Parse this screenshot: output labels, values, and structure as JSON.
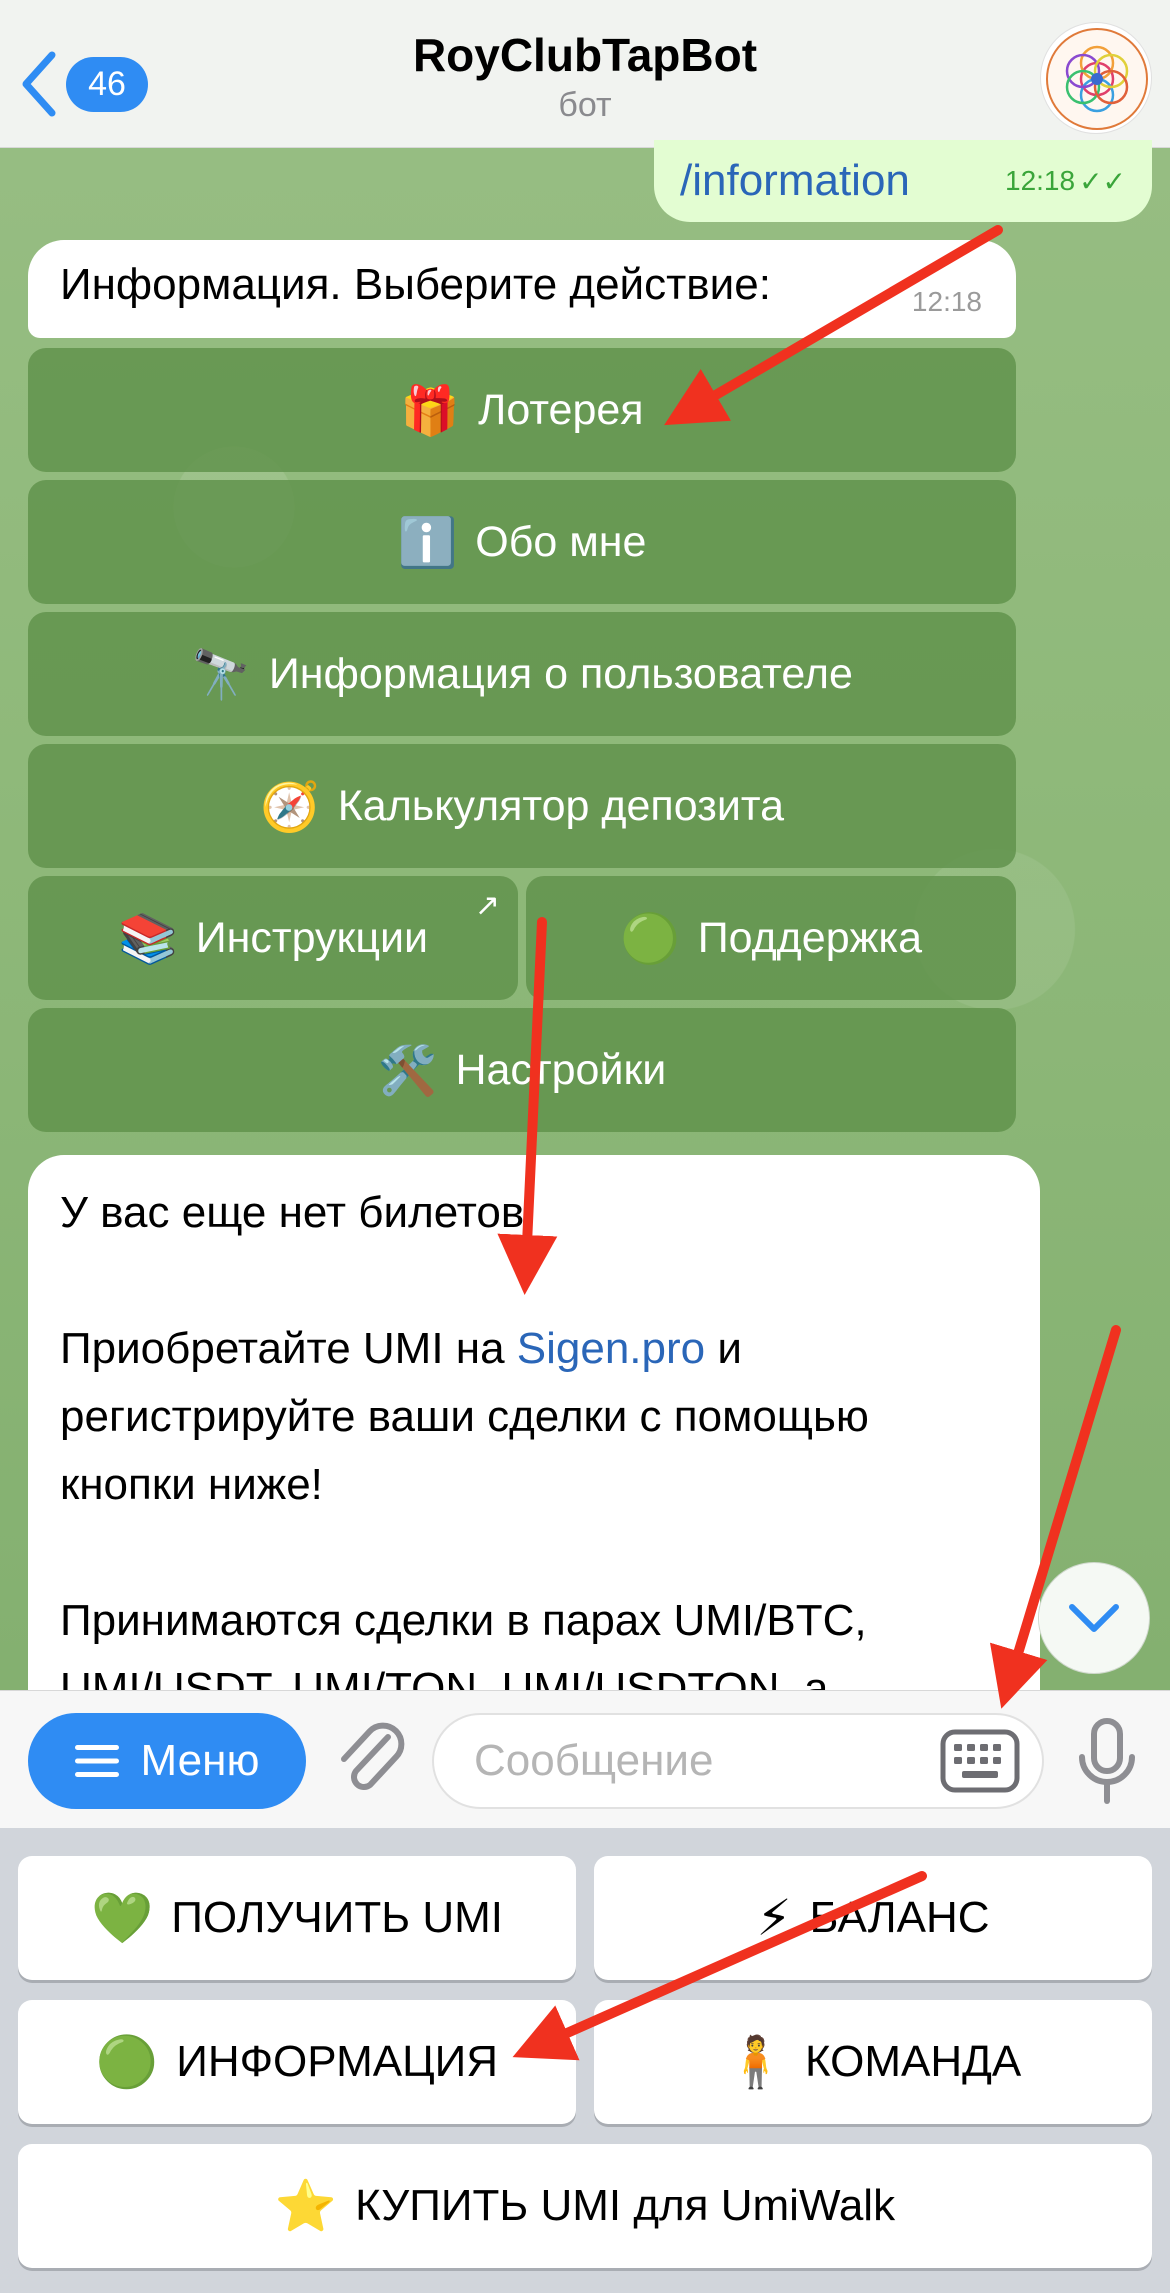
{
  "header": {
    "back_count": "46",
    "title": "RoyClubTapBot",
    "subtitle": "бот"
  },
  "outgoing": {
    "text": "/information",
    "time": "12:18"
  },
  "incoming": {
    "text": "Информация. Выберите действие:",
    "time": "12:18"
  },
  "inline_keyboard": {
    "lottery": {
      "emoji": "🎁",
      "label": "Лотерея"
    },
    "about": {
      "emoji": "ℹ️",
      "label": "Обо мне"
    },
    "user_info": {
      "emoji": "🔭",
      "label": "Информация о пользователе"
    },
    "deposit_calc": {
      "emoji": "🧭",
      "label": "Калькулятор депозита"
    },
    "instructions": {
      "emoji": "📚",
      "label": "Инструкции"
    },
    "support": {
      "emoji": "🟢",
      "label": "Поддержка"
    },
    "settings": {
      "emoji": "🛠️",
      "label": "Настройки"
    }
  },
  "long_message": {
    "line1": "У вас еще нет билетов.",
    "para2_pre": "Приобретайте UMI на ",
    "para2_link": "Sigen.pro",
    "para2_post": " и регистрируйте ваши сделки с помощью кнопки ниже!",
    "para3": "Принимаются сделки в парах UMI/BTC, UMI/USDT, UMI/TON, UMI/USDTON, а"
  },
  "input_bar": {
    "menu_label": "Меню",
    "placeholder": "Сообщение"
  },
  "reply_keyboard": {
    "get_umi": {
      "emoji": "💚",
      "label": "ПОЛУЧИТЬ UMI"
    },
    "balance": {
      "emoji": "⚡",
      "label": "БАЛАНС"
    },
    "information": {
      "emoji": "🟢",
      "label": "ИНФОРМАЦИЯ"
    },
    "team": {
      "emoji": "🧍",
      "label": "КОМАНДА"
    },
    "buy_umi": {
      "emoji": "⭐",
      "label": "КУПИТЬ UMI для UmiWalk"
    }
  },
  "colors": {
    "accent": "#2f8cf3",
    "annotation_arrow": "#f0311f",
    "bubble_out": "#e3fdd2",
    "inline_button": "#5f914b"
  }
}
